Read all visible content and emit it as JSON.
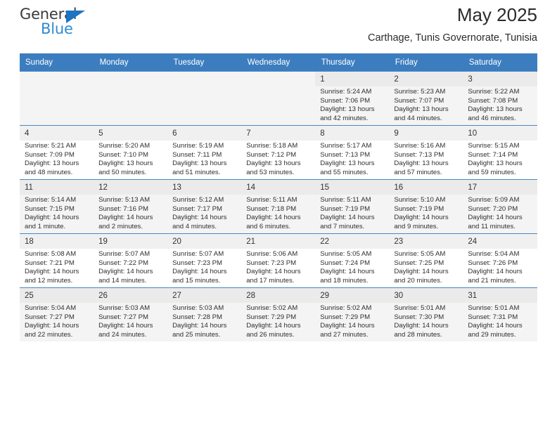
{
  "brand": {
    "name_top": "General",
    "name_bottom": "Blue",
    "triangle_color": "#1c74c4",
    "blue_color": "#2e8bd6"
  },
  "header": {
    "title": "May 2025",
    "subtitle": "Carthage, Tunis Governorate, Tunisia"
  },
  "theme": {
    "header_row_bg": "#3c7dbf",
    "header_row_text": "#ffffff",
    "alt_row_bg": "#f4f4f4",
    "daynum_bg": "#f0f0f0",
    "grid_line": "#4a87c6"
  },
  "weekdays": [
    "Sunday",
    "Monday",
    "Tuesday",
    "Wednesday",
    "Thursday",
    "Friday",
    "Saturday"
  ],
  "labels": {
    "sunrise": "Sunrise:",
    "sunset": "Sunset:",
    "daylight": "Daylight:"
  },
  "weeks": [
    [
      {
        "day": "",
        "empty": true
      },
      {
        "day": "",
        "empty": true
      },
      {
        "day": "",
        "empty": true
      },
      {
        "day": "",
        "empty": true
      },
      {
        "day": "1",
        "sunrise": "Sunrise: 5:24 AM",
        "sunset": "Sunset: 7:06 PM",
        "daylight": "Daylight: 13 hours and 42 minutes."
      },
      {
        "day": "2",
        "sunrise": "Sunrise: 5:23 AM",
        "sunset": "Sunset: 7:07 PM",
        "daylight": "Daylight: 13 hours and 44 minutes."
      },
      {
        "day": "3",
        "sunrise": "Sunrise: 5:22 AM",
        "sunset": "Sunset: 7:08 PM",
        "daylight": "Daylight: 13 hours and 46 minutes."
      }
    ],
    [
      {
        "day": "4",
        "sunrise": "Sunrise: 5:21 AM",
        "sunset": "Sunset: 7:09 PM",
        "daylight": "Daylight: 13 hours and 48 minutes."
      },
      {
        "day": "5",
        "sunrise": "Sunrise: 5:20 AM",
        "sunset": "Sunset: 7:10 PM",
        "daylight": "Daylight: 13 hours and 50 minutes."
      },
      {
        "day": "6",
        "sunrise": "Sunrise: 5:19 AM",
        "sunset": "Sunset: 7:11 PM",
        "daylight": "Daylight: 13 hours and 51 minutes."
      },
      {
        "day": "7",
        "sunrise": "Sunrise: 5:18 AM",
        "sunset": "Sunset: 7:12 PM",
        "daylight": "Daylight: 13 hours and 53 minutes."
      },
      {
        "day": "8",
        "sunrise": "Sunrise: 5:17 AM",
        "sunset": "Sunset: 7:13 PM",
        "daylight": "Daylight: 13 hours and 55 minutes."
      },
      {
        "day": "9",
        "sunrise": "Sunrise: 5:16 AM",
        "sunset": "Sunset: 7:13 PM",
        "daylight": "Daylight: 13 hours and 57 minutes."
      },
      {
        "day": "10",
        "sunrise": "Sunrise: 5:15 AM",
        "sunset": "Sunset: 7:14 PM",
        "daylight": "Daylight: 13 hours and 59 minutes."
      }
    ],
    [
      {
        "day": "11",
        "sunrise": "Sunrise: 5:14 AM",
        "sunset": "Sunset: 7:15 PM",
        "daylight": "Daylight: 14 hours and 1 minute."
      },
      {
        "day": "12",
        "sunrise": "Sunrise: 5:13 AM",
        "sunset": "Sunset: 7:16 PM",
        "daylight": "Daylight: 14 hours and 2 minutes."
      },
      {
        "day": "13",
        "sunrise": "Sunrise: 5:12 AM",
        "sunset": "Sunset: 7:17 PM",
        "daylight": "Daylight: 14 hours and 4 minutes."
      },
      {
        "day": "14",
        "sunrise": "Sunrise: 5:11 AM",
        "sunset": "Sunset: 7:18 PM",
        "daylight": "Daylight: 14 hours and 6 minutes."
      },
      {
        "day": "15",
        "sunrise": "Sunrise: 5:11 AM",
        "sunset": "Sunset: 7:19 PM",
        "daylight": "Daylight: 14 hours and 7 minutes."
      },
      {
        "day": "16",
        "sunrise": "Sunrise: 5:10 AM",
        "sunset": "Sunset: 7:19 PM",
        "daylight": "Daylight: 14 hours and 9 minutes."
      },
      {
        "day": "17",
        "sunrise": "Sunrise: 5:09 AM",
        "sunset": "Sunset: 7:20 PM",
        "daylight": "Daylight: 14 hours and 11 minutes."
      }
    ],
    [
      {
        "day": "18",
        "sunrise": "Sunrise: 5:08 AM",
        "sunset": "Sunset: 7:21 PM",
        "daylight": "Daylight: 14 hours and 12 minutes."
      },
      {
        "day": "19",
        "sunrise": "Sunrise: 5:07 AM",
        "sunset": "Sunset: 7:22 PM",
        "daylight": "Daylight: 14 hours and 14 minutes."
      },
      {
        "day": "20",
        "sunrise": "Sunrise: 5:07 AM",
        "sunset": "Sunset: 7:23 PM",
        "daylight": "Daylight: 14 hours and 15 minutes."
      },
      {
        "day": "21",
        "sunrise": "Sunrise: 5:06 AM",
        "sunset": "Sunset: 7:23 PM",
        "daylight": "Daylight: 14 hours and 17 minutes."
      },
      {
        "day": "22",
        "sunrise": "Sunrise: 5:05 AM",
        "sunset": "Sunset: 7:24 PM",
        "daylight": "Daylight: 14 hours and 18 minutes."
      },
      {
        "day": "23",
        "sunrise": "Sunrise: 5:05 AM",
        "sunset": "Sunset: 7:25 PM",
        "daylight": "Daylight: 14 hours and 20 minutes."
      },
      {
        "day": "24",
        "sunrise": "Sunrise: 5:04 AM",
        "sunset": "Sunset: 7:26 PM",
        "daylight": "Daylight: 14 hours and 21 minutes."
      }
    ],
    [
      {
        "day": "25",
        "sunrise": "Sunrise: 5:04 AM",
        "sunset": "Sunset: 7:27 PM",
        "daylight": "Daylight: 14 hours and 22 minutes."
      },
      {
        "day": "26",
        "sunrise": "Sunrise: 5:03 AM",
        "sunset": "Sunset: 7:27 PM",
        "daylight": "Daylight: 14 hours and 24 minutes."
      },
      {
        "day": "27",
        "sunrise": "Sunrise: 5:03 AM",
        "sunset": "Sunset: 7:28 PM",
        "daylight": "Daylight: 14 hours and 25 minutes."
      },
      {
        "day": "28",
        "sunrise": "Sunrise: 5:02 AM",
        "sunset": "Sunset: 7:29 PM",
        "daylight": "Daylight: 14 hours and 26 minutes."
      },
      {
        "day": "29",
        "sunrise": "Sunrise: 5:02 AM",
        "sunset": "Sunset: 7:29 PM",
        "daylight": "Daylight: 14 hours and 27 minutes."
      },
      {
        "day": "30",
        "sunrise": "Sunrise: 5:01 AM",
        "sunset": "Sunset: 7:30 PM",
        "daylight": "Daylight: 14 hours and 28 minutes."
      },
      {
        "day": "31",
        "sunrise": "Sunrise: 5:01 AM",
        "sunset": "Sunset: 7:31 PM",
        "daylight": "Daylight: 14 hours and 29 minutes."
      }
    ]
  ]
}
